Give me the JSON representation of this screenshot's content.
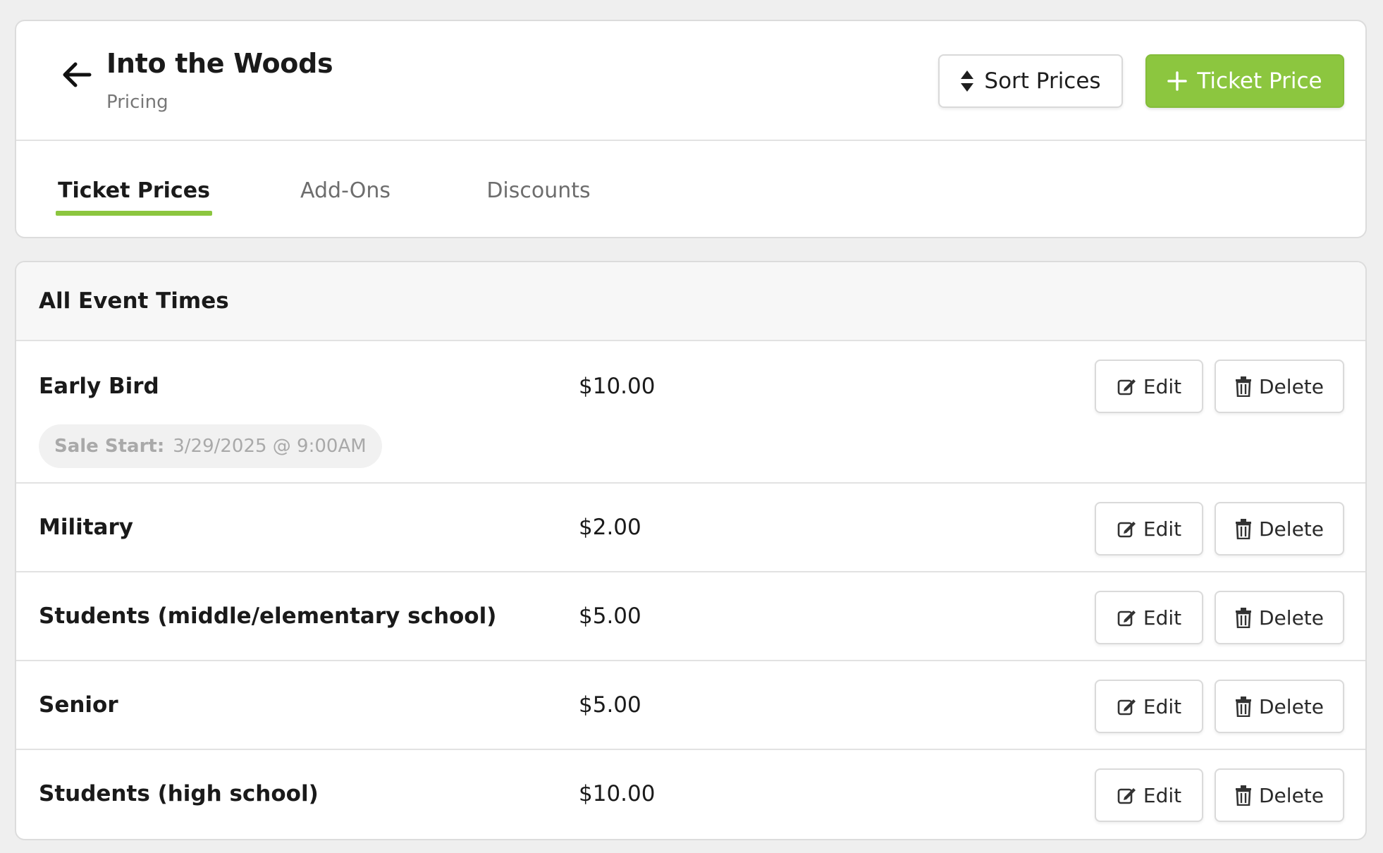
{
  "header": {
    "title": "Into the Woods",
    "subtitle": "Pricing",
    "sort_label": "Sort Prices",
    "add_label": "Ticket Price"
  },
  "tabs": [
    {
      "label": "Ticket Prices",
      "active": true
    },
    {
      "label": "Add-Ons",
      "active": false
    },
    {
      "label": "Discounts",
      "active": false
    }
  ],
  "section": {
    "title": "All Event Times"
  },
  "actions": {
    "edit": "Edit",
    "delete": "Delete"
  },
  "prices": [
    {
      "name": "Early Bird",
      "price": "$10.00",
      "sale_label": "Sale Start:",
      "sale_value": "3/29/2025 @ 9:00AM"
    },
    {
      "name": "Military",
      "price": "$2.00"
    },
    {
      "name": "Students (middle/elementary school)",
      "price": "$5.00"
    },
    {
      "name": "Senior",
      "price": "$5.00"
    },
    {
      "name": "Students (high school)",
      "price": "$10.00"
    }
  ],
  "colors": {
    "accent": "#8cc63f",
    "text": "#1a1a1a",
    "muted": "#777777"
  },
  "icons": {
    "back": "arrow-left-icon",
    "sort": "sort-icon",
    "add": "plus-icon",
    "edit": "edit-icon",
    "delete": "trash-icon"
  }
}
